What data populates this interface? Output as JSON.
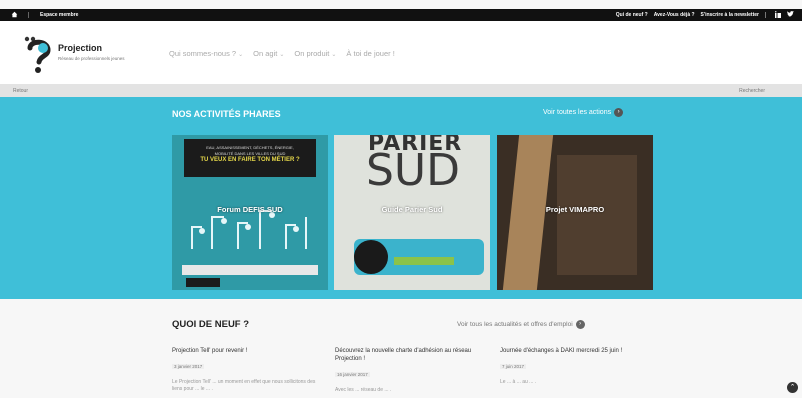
{
  "topbar": {
    "members_label": "Espace membre",
    "links": [
      "Qui de neuf ?",
      "Avez-Vous déjà ?",
      "S'inscrire à la newsletter"
    ]
  },
  "header": {
    "site_name": "Projection",
    "tagline": "Réseau de professionnels jeunes",
    "nav": [
      "Qui sommes-nous ?",
      "On agit",
      "On produit",
      "À toi de jouer !"
    ]
  },
  "crumbs": {
    "back": "Retour",
    "search": "Rechercher"
  },
  "activities": {
    "title": "NOS ACTIVITÉS PHARES",
    "see_all": "Voir toutes les actions",
    "cards": [
      {
        "label": "Forum DEFIS SUD",
        "panel_line1": "EAU, ASSAINISSEMENT, DÉCHETS, ÉNERGIE,",
        "panel_line2": "MOBILITÉ DANS LES VILLES DU SUD",
        "panel_line3": "TU VEUX EN FAIRE TON MÉTIER ?"
      },
      {
        "label": "Guide Parier Sud",
        "pt": "PARIER",
        "sud": "SUD"
      },
      {
        "label": "Projet VIMAPRO"
      }
    ]
  },
  "news": {
    "title": "QUOI DE NEUF ?",
    "see_all": "Voir tous les actualités et offres d'emploi",
    "items": [
      {
        "headline": "Projection Tell' pour revenir !",
        "date": "3 janvier 2017",
        "text": "Le Projection Tell' ... un moment en effet que nous sollicitons des liens pour ... le ... ."
      },
      {
        "headline": "Découvrez la nouvelle charte d'adhésion au réseau Projection !",
        "date": "16 janvier 2017",
        "text": "Avec les ... réseau de ... ."
      },
      {
        "headline": "Journée d'échanges à DAKI mercredi 25 juin !",
        "date": "7 juin 2017",
        "text": "Le ... à ... au ... ."
      }
    ]
  }
}
